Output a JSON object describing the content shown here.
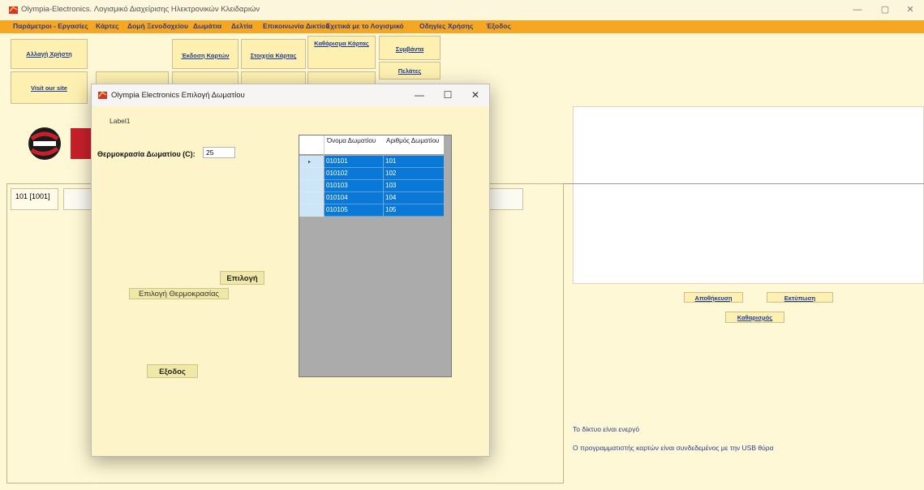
{
  "window": {
    "title": "Olympia-Electronics. Λογισμικό Διαχείρισης Ηλεκτρονικών Κλειδαριών",
    "controls": [
      "—",
      "▢",
      "✕"
    ]
  },
  "menu": {
    "items": [
      "Παράμετροι - Εργασίες",
      "Κάρτες",
      "Δομή Ξενοδοχείου",
      "Δωμάτια",
      "Δελτία",
      "Επικοινωνία Δικτίου",
      "Σχετικά με το Λογισμικό",
      "Οδηγίες Χρήσης",
      "Έξοδος"
    ]
  },
  "toolbar": {
    "change_user": "Αλλαγή Χρήστη",
    "issue_cards": "Έκδοση Καρτών",
    "card_info": "Στοιχεία Κάρτας",
    "clear_card": "Καθάρισμα Κάρτας",
    "events": "Συμβάντα",
    "customers": "Πελάτες",
    "visit_site": "Visit our site"
  },
  "rooms": {
    "tab_label": "101 [1001]"
  },
  "right_panel": {
    "save": "Αποθήκευση",
    "print": "Εκτύπωση",
    "clear": "Καθαρισμός",
    "status_network": "Το δίκτυο είναι ενεργό",
    "status_programmer": "Ο προγραμματιστής καρτών είναι συνδεδεμένος με την USB θύρα"
  },
  "dialog": {
    "title": "Olympia Electronics Επιλογή Δωματίου",
    "controls": [
      "—",
      "☐",
      "✕"
    ],
    "label1": "Label1",
    "temp_label": "Θερμοκρασία  Δωματίου (C):",
    "temp_value": "25",
    "select_button": "Επιλογή",
    "select_temp": "Επιλογή Θερμοκρασίας",
    "exit_button": "Εξοδος",
    "grid": {
      "headers": [
        "Όνομα Δωματίου",
        "Αριθμός Δωματίου"
      ],
      "rows": [
        [
          "010101",
          "101"
        ],
        [
          "010102",
          "102"
        ],
        [
          "010103",
          "103"
        ],
        [
          "010104",
          "104"
        ],
        [
          "010105",
          "105"
        ]
      ],
      "row_marker": "▸"
    }
  },
  "colors": {
    "menu_bg": "#f5a623",
    "workspace_bg": "#fff8d6",
    "selection": "#0a78d7"
  }
}
